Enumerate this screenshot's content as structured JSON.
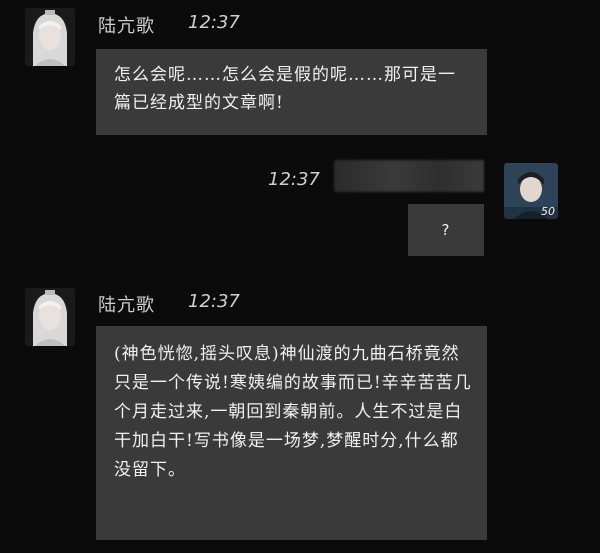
{
  "messages": [
    {
      "sender": "陆亢歌",
      "time": "12:37",
      "text": "怎么会呢……怎么会是假的呢……那可是一篇已经成型的文章啊!"
    },
    {
      "sender": "",
      "time": "12:37",
      "text": "?",
      "level": "50"
    },
    {
      "sender": "陆亢歌",
      "time": "12:37",
      "text": "(神色恍惚,摇头叹息)神仙渡的九曲石桥竟然只是一个传说!寒姨编的故事而已!辛辛苦苦几个月走过来,一朝回到秦朝前。人生不过是白干加白干!写书像是一场梦,梦醒时分,什么都没留下。"
    }
  ],
  "icons": {
    "npc_avatar": "white-haired-character-avatar",
    "player_avatar": "player-avatar"
  }
}
